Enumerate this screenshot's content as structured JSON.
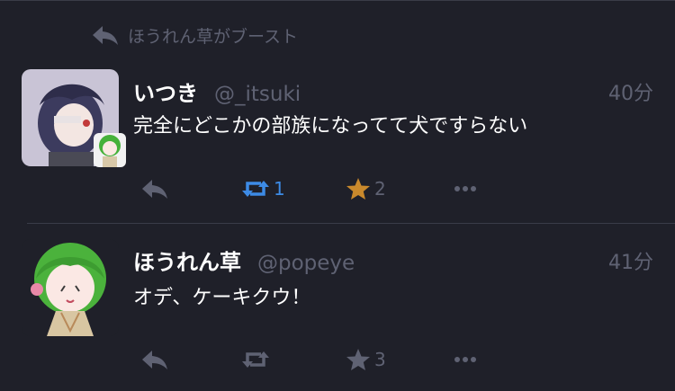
{
  "boost": {
    "label": "ほうれん草がブースト"
  },
  "statuses": [
    {
      "display_name": "いつき",
      "acct": "@_itsuki",
      "time": "40分",
      "content": "完全にどこかの部族になってて犬ですらない",
      "reblogs": "1",
      "favourites": "2",
      "reblog_color": "#3d8be6",
      "fav_color": "#c9892c"
    },
    {
      "display_name": "ほうれん草",
      "acct": "@popeye",
      "time": "41分",
      "content": "オデ、ケーキクウ！",
      "reblogs": "",
      "favourites": "3",
      "reblog_color": "#5f6273",
      "fav_color": "#5f6273"
    }
  ],
  "icons": {
    "boost": "reply-arrow-icon",
    "reply": "reply-icon",
    "reblog": "retweet-icon",
    "favourite": "star-icon",
    "more": "ellipsis-icon"
  }
}
